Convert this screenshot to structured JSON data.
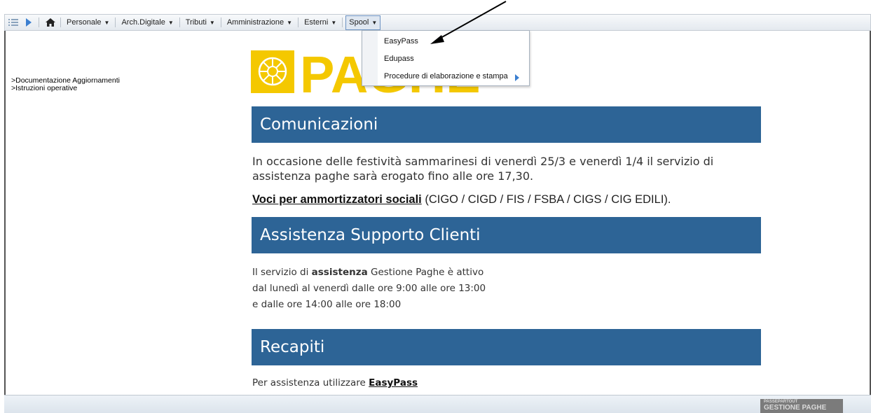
{
  "toolbar": {
    "menus": [
      {
        "label": "Personale"
      },
      {
        "label": "Arch.Digitale"
      },
      {
        "label": "Tributi"
      },
      {
        "label": "Amministrazione"
      },
      {
        "label": "Esterni"
      },
      {
        "label": "Spool"
      }
    ],
    "active_menu": "Spool"
  },
  "dropdown": {
    "items": [
      {
        "label": "EasyPass"
      },
      {
        "label": "Edupass"
      },
      {
        "label": "Procedure di elaborazione e stampa"
      }
    ]
  },
  "sidebar": {
    "links": [
      {
        "label": ">Documentazione Aggiornamenti"
      },
      {
        "label": ">Istruzioni operative"
      }
    ]
  },
  "logo": {
    "text": "PAGHE"
  },
  "sections": {
    "comunicazioni": {
      "title": "Comunicazioni",
      "text": "In occasione delle festività sammarinesi di venerdì 25/3 e venerdì 1/4 il servizio di assistenza paghe sarà erogato fino alle ore 17,30.",
      "link_label": "Voci per ammortizzatori sociali",
      "link_suffix": " (CIGO / CIGD / FIS / FSBA / CIGS / CIG EDILI)."
    },
    "assistenza": {
      "title": "Assistenza Supporto Clienti",
      "line1_prefix": "Il servizio di ",
      "line1_bold": "assistenza",
      "line1_suffix": " Gestione Paghe è attivo",
      "line2": "dal lunedì al venerdì dalle ore 9:00 alle ore 13:00",
      "line3": "e dalle ore 14:00 alle ore 18:00"
    },
    "recapiti": {
      "title": "Recapiti",
      "text_prefix": "Per assistenza utilizzare ",
      "link_label": "EasyPass"
    }
  },
  "footer": {
    "brand_small": "PASSEPARTOUT",
    "brand_main": "GESTIONE PAGHE"
  },
  "colors": {
    "banner": "#2d6496",
    "logo_yellow": "#f4c800",
    "toolbar_bg": "#e4e9ef"
  }
}
